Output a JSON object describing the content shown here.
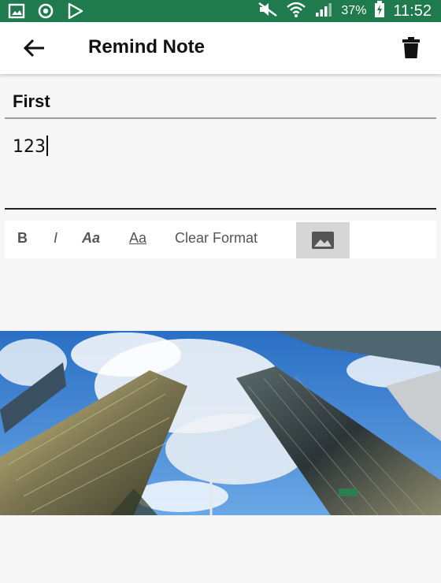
{
  "status_bar": {
    "battery": "37%",
    "time": "11:52",
    "icons": [
      "gallery-icon",
      "sync-icon",
      "play-store-icon",
      "mute-icon",
      "wifi-icon",
      "signal-icon",
      "battery-charging-icon"
    ]
  },
  "app_bar": {
    "title": "Remind Note",
    "back_icon": "arrow-left-icon",
    "delete_icon": "trash-icon"
  },
  "note": {
    "title": "First",
    "body": "123"
  },
  "toolbar": {
    "bold": "B",
    "italic": "I",
    "bold_italic": "Aa",
    "underline": "Aa",
    "clear_format": "Clear Format",
    "image_icon": "image-icon"
  },
  "colors": {
    "status_bar": "#1f7a4d",
    "app_bar": "#ffffff",
    "background": "#f6f6f6"
  }
}
